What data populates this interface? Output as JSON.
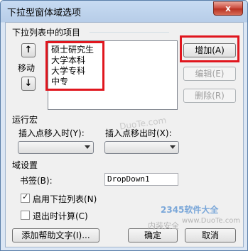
{
  "window": {
    "title": "下拉型窗体域选项",
    "close_glyph": "x"
  },
  "items_section": {
    "label": "下拉列表中的项目",
    "move_label": "移动",
    "up_glyph": "↑",
    "down_glyph": "↓",
    "items": [
      "硕士研究生",
      "大学本科",
      "大学专科",
      "中专"
    ],
    "add_button": "增加(A)",
    "edit_button": "编辑(E)",
    "delete_button": "删除(R)"
  },
  "macro_section": {
    "label": "运行宏",
    "entry_label": "插入点移入时(Y):",
    "exit_label": "插入点移出时(X):",
    "entry_value": "",
    "exit_value": ""
  },
  "field_section": {
    "label": "域设置",
    "bookmark_label": "书签(B):",
    "bookmark_value": "DropDown1",
    "enable_dropdown_label": "启用下拉列表(N)",
    "enable_dropdown_checked": true,
    "calc_on_exit_label": "退出时计算(C)",
    "calc_on_exit_checked": false
  },
  "footer": {
    "help_text_button": "添加帮助文字(I)...",
    "ok_button": "确定",
    "cancel_button": "取消"
  },
  "watermarks": {
    "duote": "DuoTe.com",
    "logo_2345": "2345软件大全",
    "slogan": "内装安全",
    "duote_small": "www.DuoTe.com"
  },
  "colors": {
    "highlight_red": "#e0161e",
    "title_bar": "#b7cde8",
    "close_red": "#c9483a"
  }
}
